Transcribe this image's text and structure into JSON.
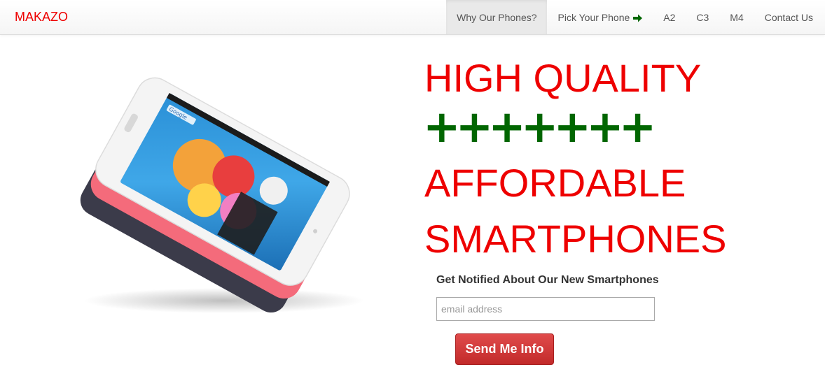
{
  "brand": {
    "name": "MAKAZO",
    "color": "#ee0000"
  },
  "nav": {
    "items": [
      {
        "label": "Why Our Phones?",
        "active": true
      },
      {
        "label": "Pick Your Phone",
        "icon": "arrow-right-icon"
      },
      {
        "label": "A2"
      },
      {
        "label": "C3"
      },
      {
        "label": "M4"
      },
      {
        "label": "Contact Us"
      }
    ]
  },
  "hero": {
    "line1": "HIGH QUALITY",
    "plus_signs": "+++++++",
    "line2": "AFFORDABLE",
    "line3": "SMARTPHONES",
    "headline_color": "#ee0000",
    "plus_color": "#006600",
    "phone_image": {
      "icon": "smartphone-stack-image",
      "screen_label": "Google"
    }
  },
  "signup": {
    "heading": "Get Notified About Our New Smartphones",
    "email_placeholder": "email address",
    "button_label": "Send Me Info",
    "button_color": "#c9302c"
  }
}
